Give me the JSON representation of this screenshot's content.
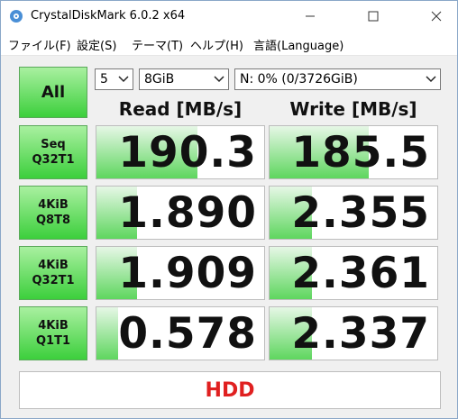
{
  "window": {
    "title": "CrystalDiskMark 6.0.2 x64"
  },
  "menu": [
    "ファイル(F)",
    "設定(S)",
    "テーマ(T)",
    "ヘルプ(H)",
    "言語(Language)"
  ],
  "controls": {
    "all_label": "All",
    "count": "5",
    "size": "8GiB",
    "drive": "N: 0% (0/3726GiB)"
  },
  "headers": {
    "read": "Read [MB/s]",
    "write": "Write [MB/s]"
  },
  "tests": [
    {
      "line1": "Seq",
      "line2": "Q32T1",
      "read": "190.3",
      "write": "185.5",
      "read_level": 0.6,
      "write_level": 0.59
    },
    {
      "line1": "4KiB",
      "line2": "Q8T8",
      "read": "1.890",
      "write": "2.355",
      "read_level": 0.24,
      "write_level": 0.25
    },
    {
      "line1": "4KiB",
      "line2": "Q32T1",
      "read": "1.909",
      "write": "2.361",
      "read_level": 0.24,
      "write_level": 0.25
    },
    {
      "line1": "4KiB",
      "line2": "Q1T1",
      "read": "0.578",
      "write": "2.337",
      "read_level": 0.13,
      "write_level": 0.25
    }
  ],
  "comment": "HDD",
  "colors": {
    "button_green": "#3ccf3c",
    "bar_green": "#5ed65e",
    "comment_red": "#e02020"
  }
}
